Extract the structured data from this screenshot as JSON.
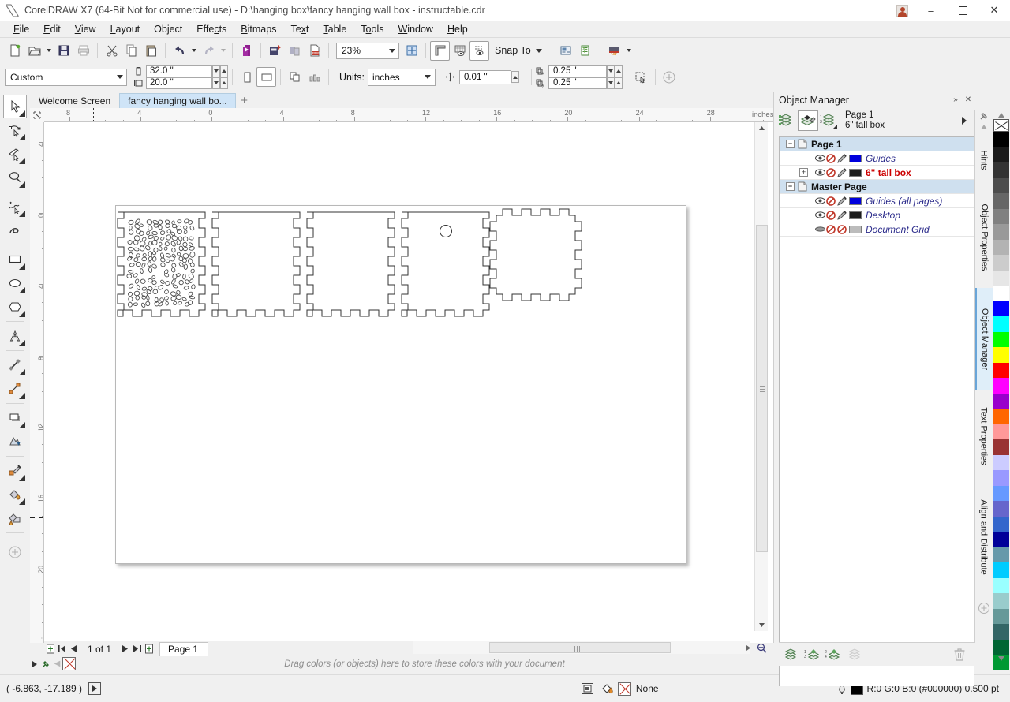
{
  "window": {
    "title": "CorelDRAW X7 (64-Bit Not for commercial use) - D:\\hanging box\\fancy hanging wall box - instructable.cdr",
    "logo_icon": "coreldraw-logo-icon",
    "account_icon": "user-account-icon",
    "minimize_label": "–",
    "maximize_label": "❐",
    "close_label": "✕"
  },
  "menu": {
    "items": [
      {
        "label": "File"
      },
      {
        "label": "Edit"
      },
      {
        "label": "View"
      },
      {
        "label": "Layout"
      },
      {
        "label": "Object"
      },
      {
        "label": "Effects"
      },
      {
        "label": "Bitmaps"
      },
      {
        "label": "Text"
      },
      {
        "label": "Table"
      },
      {
        "label": "Tools"
      },
      {
        "label": "Window"
      },
      {
        "label": "Help"
      }
    ]
  },
  "standard_toolbar": {
    "buttons": [
      {
        "name": "new-document-button",
        "icon": "new-document-icon"
      },
      {
        "name": "open-document-button",
        "icon": "open-folder-icon"
      },
      {
        "name": "save-button",
        "icon": "save-disk-icon"
      },
      {
        "name": "print-button",
        "icon": "printer-icon"
      },
      {
        "name": "cut-button",
        "icon": "scissors-icon"
      },
      {
        "name": "copy-button",
        "icon": "copy-icon"
      },
      {
        "name": "paste-button",
        "icon": "paste-icon"
      },
      {
        "name": "undo-button",
        "icon": "undo-arrow-icon"
      },
      {
        "name": "redo-button",
        "icon": "redo-arrow-icon"
      },
      {
        "name": "import-button",
        "icon": "import-icon"
      },
      {
        "name": "export-button",
        "icon": "export-icon"
      },
      {
        "name": "export-to-office-button",
        "icon": "export-office-icon"
      },
      {
        "name": "publish-to-pdf-button",
        "icon": "pdf-icon"
      }
    ],
    "zoom_level": "23%",
    "zoom_dropdown_icon": "chevron-down-icon",
    "full_screen_preview_icon": "full-screen-preview-icon",
    "show_rulers_icon": "rulers-icon",
    "show_grid_icon": "grid-icon",
    "show_guidelines_icon": "guidelines-icon",
    "snap_to_label": "Snap To",
    "options_icon": "options-icon",
    "document_properties_icon": "document-properties-icon",
    "application_launcher_icon": "application-launcher-icon"
  },
  "property_bar": {
    "page_size": "Custom",
    "page_width": "32.0 \"",
    "page_height": "20.0 \"",
    "width_icon": "page-width-icon",
    "height_icon": "page-height-icon",
    "portrait_icon": "portrait-orientation-icon",
    "landscape_icon": "landscape-orientation-icon",
    "all_pages_icon": "all-pages-icon",
    "current_page_icon": "current-page-icon",
    "units_label": "Units:",
    "units_value": "inches",
    "nudge_icon": "nudge-offset-icon",
    "nudge_value": "0.01 \"",
    "duplicate_x_icon": "duplicate-distance-x-icon",
    "duplicate_x": "0.25 \"",
    "duplicate_y_icon": "duplicate-distance-y-icon",
    "duplicate_y": "0.25 \"",
    "treat_as_filled_icon": "treat-all-objects-as-filled-icon",
    "add_icon": "plus-circle-icon"
  },
  "toolbox": {
    "tools": [
      {
        "name": "pick-tool",
        "icon": "arrow-cursor-icon",
        "active": true,
        "flyout": true
      },
      {
        "name": "shape-tool",
        "icon": "shape-node-edit-icon",
        "active": false,
        "flyout": true
      },
      {
        "name": "crop-tool",
        "icon": "crop-knife-icon",
        "active": false,
        "flyout": true
      },
      {
        "name": "zoom-tool",
        "icon": "magnifier-icon",
        "active": false,
        "flyout": true
      },
      {
        "name": "freehand-tool",
        "icon": "freehand-curve-icon",
        "active": false,
        "flyout": true
      },
      {
        "name": "artistic-media-tool",
        "icon": "artistic-media-brush-icon",
        "active": false,
        "flyout": false
      },
      {
        "name": "rectangle-tool",
        "icon": "rectangle-icon",
        "active": false,
        "flyout": true
      },
      {
        "name": "ellipse-tool",
        "icon": "ellipse-icon",
        "active": false,
        "flyout": true
      },
      {
        "name": "polygon-tool",
        "icon": "polygon-icon",
        "active": false,
        "flyout": true
      },
      {
        "name": "text-tool",
        "icon": "text-A-icon",
        "active": false,
        "flyout": true
      },
      {
        "name": "parallel-dimension-tool",
        "icon": "dimension-line-icon",
        "active": false,
        "flyout": true
      },
      {
        "name": "straight-line-connector-tool",
        "icon": "connector-line-icon",
        "active": false,
        "flyout": true
      },
      {
        "name": "drop-shadow-tool",
        "icon": "drop-shadow-icon",
        "active": false,
        "flyout": true
      },
      {
        "name": "transparency-tool",
        "icon": "transparency-icon",
        "active": false,
        "flyout": false
      },
      {
        "name": "color-eyedropper-tool",
        "icon": "eyedropper-icon",
        "active": false,
        "flyout": true
      },
      {
        "name": "interactive-fill-tool",
        "icon": "fill-bucket-icon",
        "active": false,
        "flyout": true
      },
      {
        "name": "smart-fill-tool",
        "icon": "smart-fill-icon",
        "active": false,
        "flyout": false
      },
      {
        "name": "add-tool-button",
        "icon": "plus-circle-icon",
        "active": false,
        "flyout": false
      }
    ]
  },
  "document_tabs": {
    "tabs": [
      {
        "label": "Welcome Screen",
        "active": false
      },
      {
        "label": "fancy hanging wall bo...",
        "active": true
      }
    ],
    "add_tab_label": "+"
  },
  "rulers": {
    "horizontal_unit_label": "inches",
    "vertical_unit_label": "inches",
    "horizontal_ticks": [
      "8",
      "4",
      "0",
      "4",
      "8",
      "12",
      "16",
      "20",
      "24",
      "28"
    ],
    "vertical_ticks": [
      "4",
      "0",
      "4",
      "8",
      "12",
      "16",
      "20"
    ]
  },
  "canvas": {
    "description": "Laser-cut box panel layout with finger-joint edges",
    "panels": [
      {
        "name": "panel-back-perforated",
        "has_pattern": true,
        "pattern": "organic-pebble-holes"
      },
      {
        "name": "panel-side-left",
        "has_pattern": false
      },
      {
        "name": "panel-side-right",
        "has_pattern": false
      },
      {
        "name": "panel-front-with-hole",
        "has_pattern": false,
        "hole": true
      },
      {
        "name": "panel-bottom",
        "has_pattern": false
      }
    ]
  },
  "page_navigator": {
    "add_page_before_icon": "add-page-icon",
    "first_page_icon": "first-page-icon",
    "prev_page_icon": "previous-page-icon",
    "page_counter": "1 of 1",
    "next_page_icon": "next-page-icon",
    "last_page_icon": "last-page-icon",
    "add_page_after_icon": "add-page-icon",
    "page_tab_label": "Page 1"
  },
  "color_dropbar": {
    "hint": "Drag colors (or objects) here to store these colors with your document",
    "expand_icon": "expand-arrow-icon",
    "pin_icon": "pin-icon",
    "prev_icon": "previous-color-icon",
    "none_icon": "no-color-icon"
  },
  "status_bar": {
    "coordinates": "( -6.863, -17.189 )",
    "coordinates_expand_icon": "expand-arrow-icon",
    "fill_indicator_icon": "fill-swatch-icon",
    "fill_bucket_icon": "fill-bucket-icon",
    "fill_value": "None",
    "outline_pen_icon": "outline-pen-icon",
    "outline_color": "#000000",
    "outline_text": "R:0 G:0 B:0 (#000000)  0.500 pt"
  },
  "docker": {
    "title": "Object Manager",
    "collapse_icon": "double-chevron-right-icon",
    "close_icon": "close-icon",
    "buttons": [
      {
        "name": "show-object-properties-button",
        "icon": "object-properties-icon",
        "selected": false
      },
      {
        "name": "edit-across-layers-button",
        "icon": "edit-across-layers-icon",
        "selected": true
      },
      {
        "name": "layer-manager-view-button",
        "icon": "layer-manager-view-icon",
        "selected": false
      }
    ],
    "header_line1": "Page 1",
    "header_line2": "6\" tall box",
    "header_arrow_icon": "play-arrow-icon",
    "rows": [
      {
        "type": "page",
        "label": "Page 1",
        "expander": "−",
        "icon": "page-icon",
        "bold": true
      },
      {
        "type": "layer",
        "label": "Guides",
        "expander": null,
        "eye_icon": "eye-icon",
        "print_icon": "no-print-icon",
        "lock_icon": "pencil-edit-icon",
        "color": "#0000dd",
        "style": "italic-blue"
      },
      {
        "type": "layer",
        "label": "6\" tall box",
        "expander": "+",
        "eye_icon": "eye-icon",
        "print_icon": "no-print-icon",
        "lock_icon": "pencil-edit-icon",
        "color": "#1c1c1c",
        "style": "bold-red"
      },
      {
        "type": "page",
        "label": "Master Page",
        "expander": "−",
        "icon": "page-icon",
        "bold": true
      },
      {
        "type": "layer",
        "label": "Guides (all pages)",
        "expander": null,
        "eye_icon": "eye-icon",
        "print_icon": "no-print-icon",
        "lock_icon": "pencil-edit-icon",
        "color": "#0000dd",
        "style": "italic-blue"
      },
      {
        "type": "layer",
        "label": "Desktop",
        "expander": null,
        "eye_icon": "eye-icon",
        "print_icon": "no-print-icon",
        "lock_icon": "pencil-edit-icon",
        "color": "#1c1c1c",
        "style": "italic-blue"
      },
      {
        "type": "layer",
        "label": "Document Grid",
        "expander": null,
        "eye_icon": "eye-closed-icon",
        "print_icon": "no-print-icon",
        "lock_icon": "no-edit-icon",
        "color": "#bcbcbc",
        "style": "italic-blue"
      }
    ],
    "footer_buttons": [
      {
        "name": "new-layer-button",
        "icon": "new-layer-icon"
      },
      {
        "name": "new-master-layer-odd-button",
        "icon": "new-master-layer-odd-icon"
      },
      {
        "name": "new-master-layer-even-button",
        "icon": "new-master-layer-even-icon"
      },
      {
        "name": "new-master-layer-all-button",
        "icon": "new-master-layer-all-icon"
      },
      {
        "name": "delete-layer-button",
        "icon": "trash-icon"
      }
    ]
  },
  "docker_tabs": {
    "tabs": [
      {
        "label": "Hints",
        "icon": "hints-icon",
        "selected": false
      },
      {
        "label": "Object Properties",
        "icon": "object-properties-icon",
        "selected": false
      },
      {
        "label": "Object Manager",
        "icon": "object-manager-icon",
        "selected": true
      },
      {
        "label": "Text Properties",
        "icon": "text-properties-icon",
        "selected": false
      },
      {
        "label": "Align and Distribute",
        "icon": "align-distribute-icon",
        "selected": false
      }
    ],
    "add_docker_icon": "plus-circle-icon"
  },
  "palette": {
    "scroll_up_icon": "chevron-up-icon",
    "scroll_down_icon": "chevron-down-icon",
    "none_swatch_label": "No Color",
    "colors": [
      "#000000",
      "#1a1a1a",
      "#333333",
      "#4d4d4d",
      "#666666",
      "#808080",
      "#999999",
      "#b3b3b3",
      "#cccccc",
      "#e6e6e6",
      "#ffffff",
      "#0000ff",
      "#00ffff",
      "#00ff00",
      "#ffff00",
      "#ff0000",
      "#ff00ff",
      "#9900cc",
      "#ff6600",
      "#ff9999",
      "#993333",
      "#ccccff",
      "#9999ff",
      "#6699ff",
      "#6666cc",
      "#3366cc",
      "#000099",
      "#6699aa",
      "#00ccff",
      "#99ffff",
      "#99cccc",
      "#669999",
      "#336666",
      "#006633",
      "#009933"
    ]
  }
}
